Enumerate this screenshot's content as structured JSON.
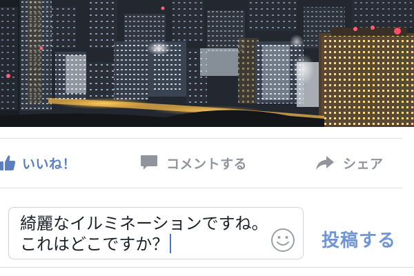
{
  "actions": {
    "like_label": "いいね！",
    "comment_label": "コメントする",
    "share_label": "シェア"
  },
  "composer": {
    "text": "綺麗なイルミネーションですね。これはどこですか？",
    "emoji_icon": "smiley-icon"
  },
  "post_button": {
    "label": "投稿する"
  },
  "colors": {
    "like_blue": "#5b80c0",
    "post_blue": "#6f95d4",
    "muted_gray": "#90949c",
    "divider": "#dedfe2"
  }
}
